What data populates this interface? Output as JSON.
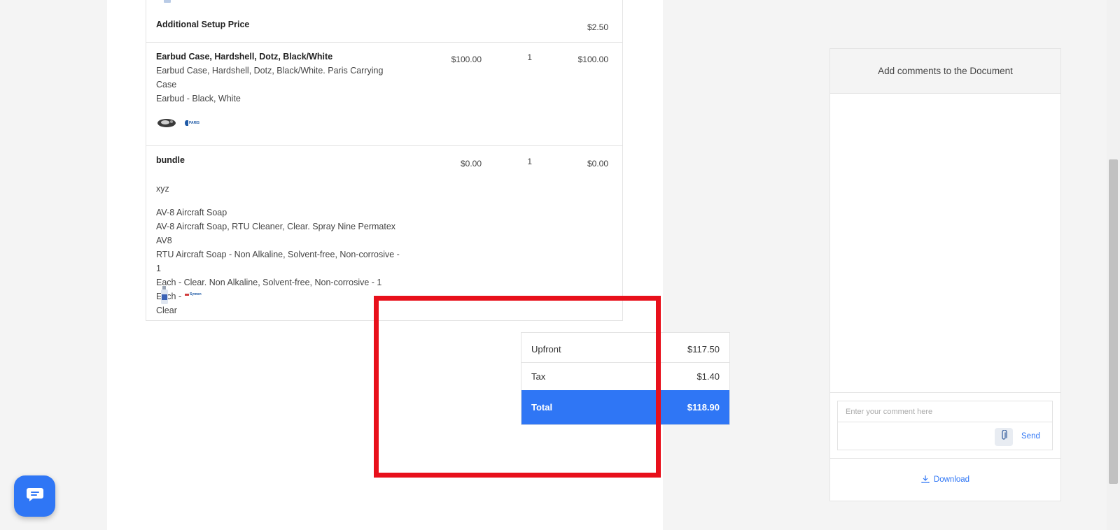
{
  "line_items": [
    {
      "name": "Additional Setup Price",
      "total": "$2.50"
    },
    {
      "name": "Earbud Case, Hardshell, Dotz, Black/White",
      "desc_line1": "Earbud Case, Hardshell, Dotz, Black/White. Paris Carrying Case",
      "desc_line2": "Earbud - Black, White",
      "unit_price": "$100.00",
      "qty": "1",
      "total": "$100.00",
      "brand": "PARIS"
    },
    {
      "name": "bundle",
      "subtitle": "xyz",
      "sub_item_name": "AV-8 Aircraft Soap",
      "desc_line1": "AV-8 Aircraft Soap, RTU Cleaner, Clear. Spray Nine Permatex AV8",
      "desc_line2": "RTU Aircraft Soap - Non Alkaline, Solvent-free, Non-corrosive - 1",
      "desc_line3": "Each - Clear. Non Alkaline, Solvent-free, Non-corrosive - 1 Each -",
      "desc_line4": "Clear",
      "unit_price": "$0.00",
      "qty": "1",
      "total": "$0.00",
      "brand": "Symon"
    }
  ],
  "summary": {
    "upfront_label": "Upfront",
    "upfront_value": "$117.50",
    "tax_label": "Tax",
    "tax_value": "$1.40",
    "total_label": "Total",
    "total_value": "$118.90"
  },
  "comments": {
    "header": "Add comments to the Document",
    "input_placeholder": "Enter your comment here",
    "send_label": "Send",
    "download_label": "Download"
  },
  "colors": {
    "accent": "#2f76f5",
    "highlight": "#e8101b"
  }
}
